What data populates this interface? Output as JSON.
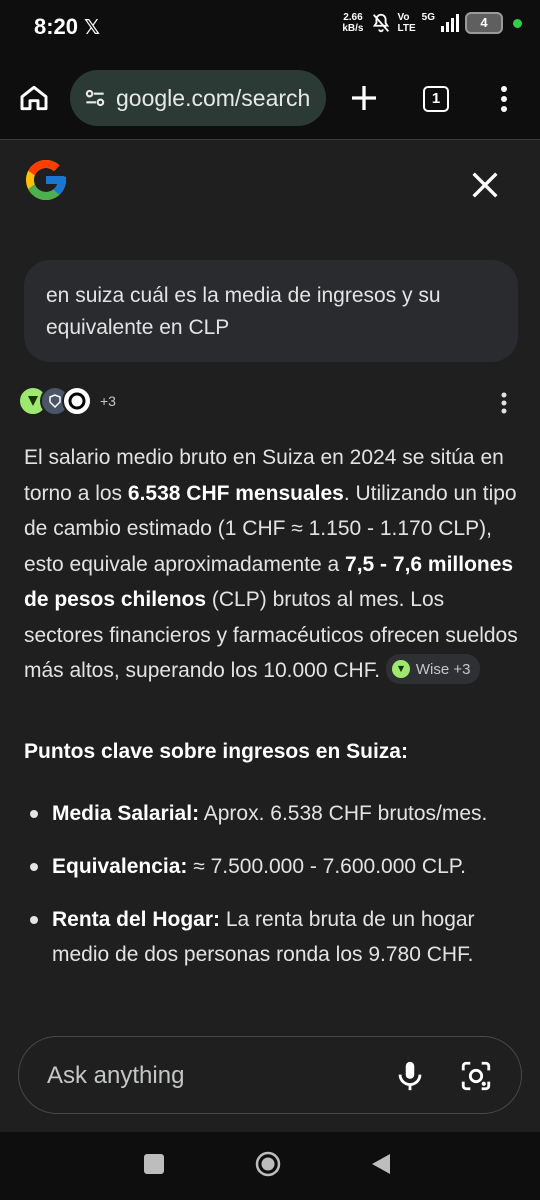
{
  "status_bar": {
    "time": "8:20",
    "speed_value": "2.66",
    "speed_unit": "kB/s",
    "network_top": "Vo",
    "network_bottom": "LTE",
    "network_gen": "5G",
    "battery": "4"
  },
  "toolbar": {
    "url": "google.com/search",
    "tab_count": "1"
  },
  "query": "en suiza cuál es la media de ingresos y su equivalente en CLP",
  "sources": {
    "more": "+3"
  },
  "answer": {
    "p1": "El salario medio bruto en Suiza en 2024 se sitúa en torno a los ",
    "b1": "6.538 CHF mensuales",
    "p2": ". Utilizando un tipo de cambio estimado (1 CHF ≈ 1.150 - 1.170 CLP), esto equivale aproximadamente a ",
    "b2": "7,5 - 7,6 millones de pesos chilenos",
    "p3": " (CLP) brutos al mes. Los sectores financieros y farmacéuticos ofrecen sueldos más altos, superando los 10.000 CHF.",
    "chip_label": "Wise +3"
  },
  "heading": "Puntos clave sobre ingresos en Suiza:",
  "bullets": [
    {
      "label": "Media Salarial:",
      "text": " Aprox. 6.538 CHF brutos/mes."
    },
    {
      "label": "Equivalencia:",
      "text": " ≈ 7.500.000 - 7.600.000 CLP."
    },
    {
      "label": "Renta del Hogar:",
      "text": " La renta bruta de un hogar medio de dos personas ronda los 9.780 CHF."
    }
  ],
  "ask_bar": {
    "placeholder": "Ask anything"
  },
  "colors": {
    "background": "#1f1f1f",
    "url_pill": "#2c3a36",
    "wise_green": "#9fe870"
  }
}
